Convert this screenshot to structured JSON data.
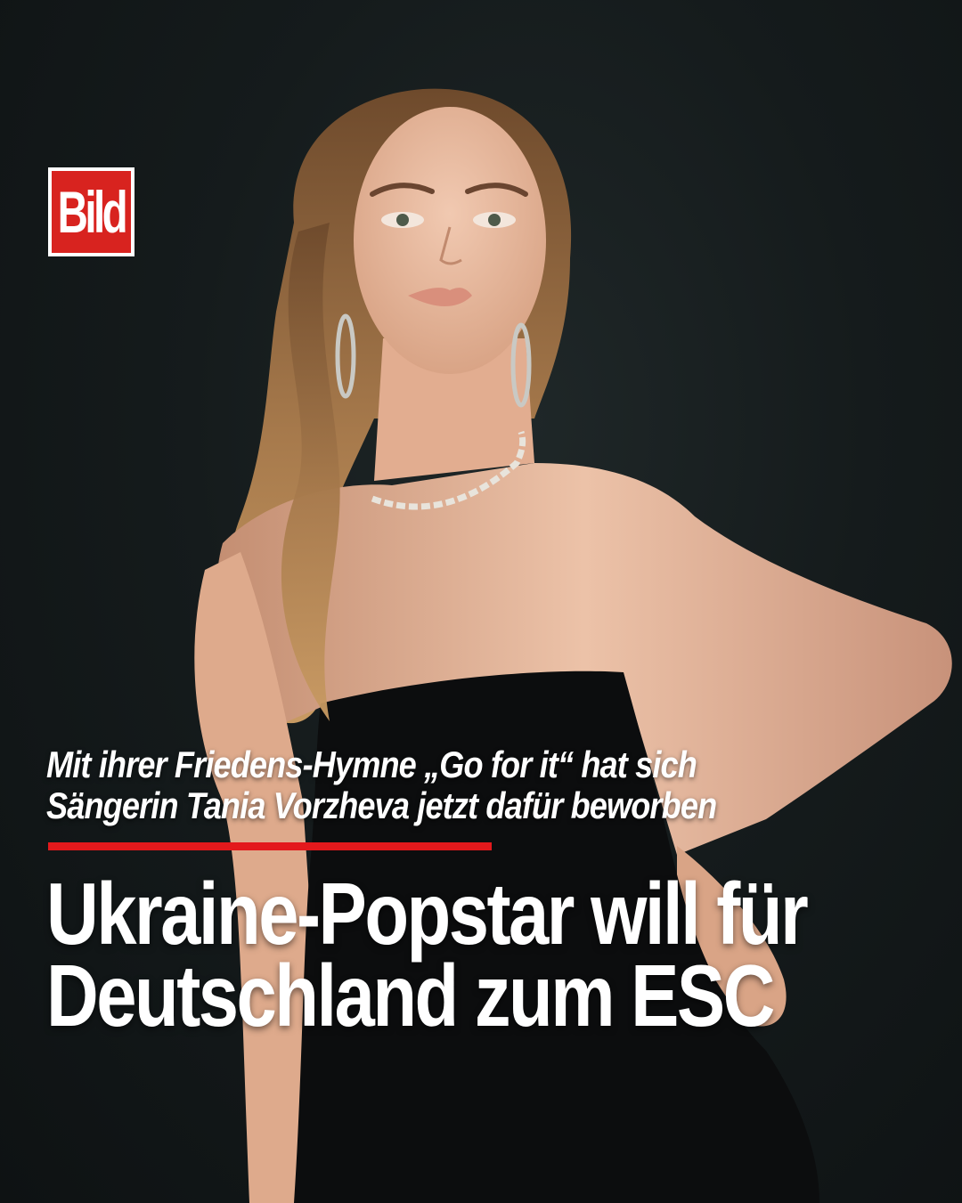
{
  "brand": {
    "logo_text": "Bild",
    "logo_color": "#d8231f"
  },
  "post": {
    "kicker_lines": [
      "Mit ihrer Friedens-Hymne „Go for it“ hat sich",
      "Sängerin Tania Vorzheva jetzt dafür beworben"
    ],
    "headline_lines": [
      "Ukraine-Popstar will für",
      "Deutschland zum ESC"
    ],
    "accent_color": "#e3191c"
  }
}
